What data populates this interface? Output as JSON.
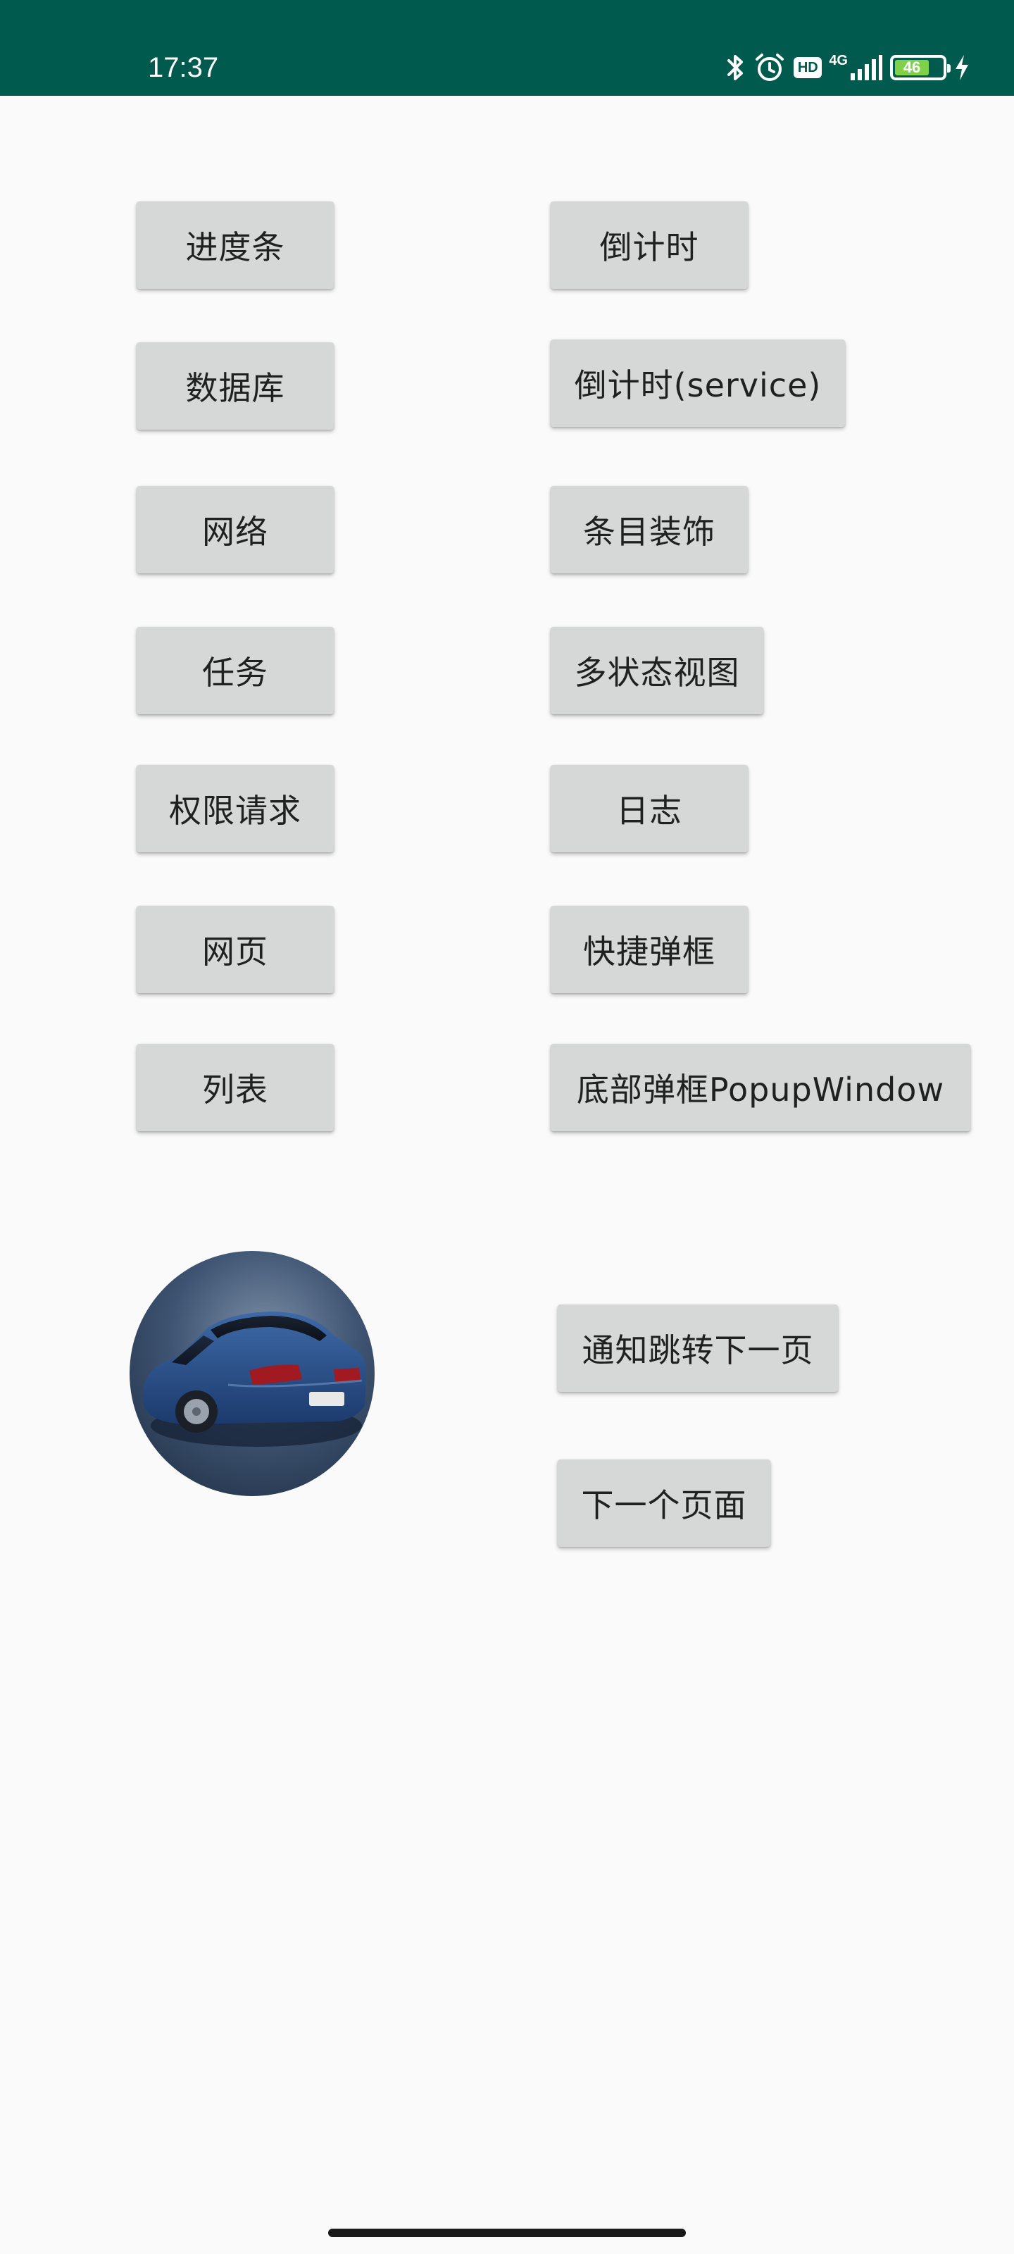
{
  "status_bar": {
    "time": "17:37",
    "network": "4G",
    "hd_badge": "HD",
    "battery_level": "46",
    "icons": [
      "bluetooth-icon",
      "alarm-icon",
      "hd-icon",
      "signal-icon",
      "battery-icon",
      "charging-icon"
    ],
    "background_color": "#005a4d"
  },
  "buttons": {
    "progress": "进度条",
    "countdown": "倒计时",
    "database": "数据库",
    "countdown_service": "倒计时(service)",
    "network": "网络",
    "item_decoration": "条目装饰",
    "task": "任务",
    "multi_state_view": "多状态视图",
    "permission": "权限请求",
    "log": "日志",
    "webpage": "网页",
    "quick_dialog": "快捷弹框",
    "list": "列表",
    "bottom_popup": "底部弹框PopupWindow",
    "notify_next": "通知跳转下一页",
    "next_page": "下一个页面"
  },
  "colors": {
    "button_background": "#d6d7d7",
    "page_background": "#fafafa"
  }
}
